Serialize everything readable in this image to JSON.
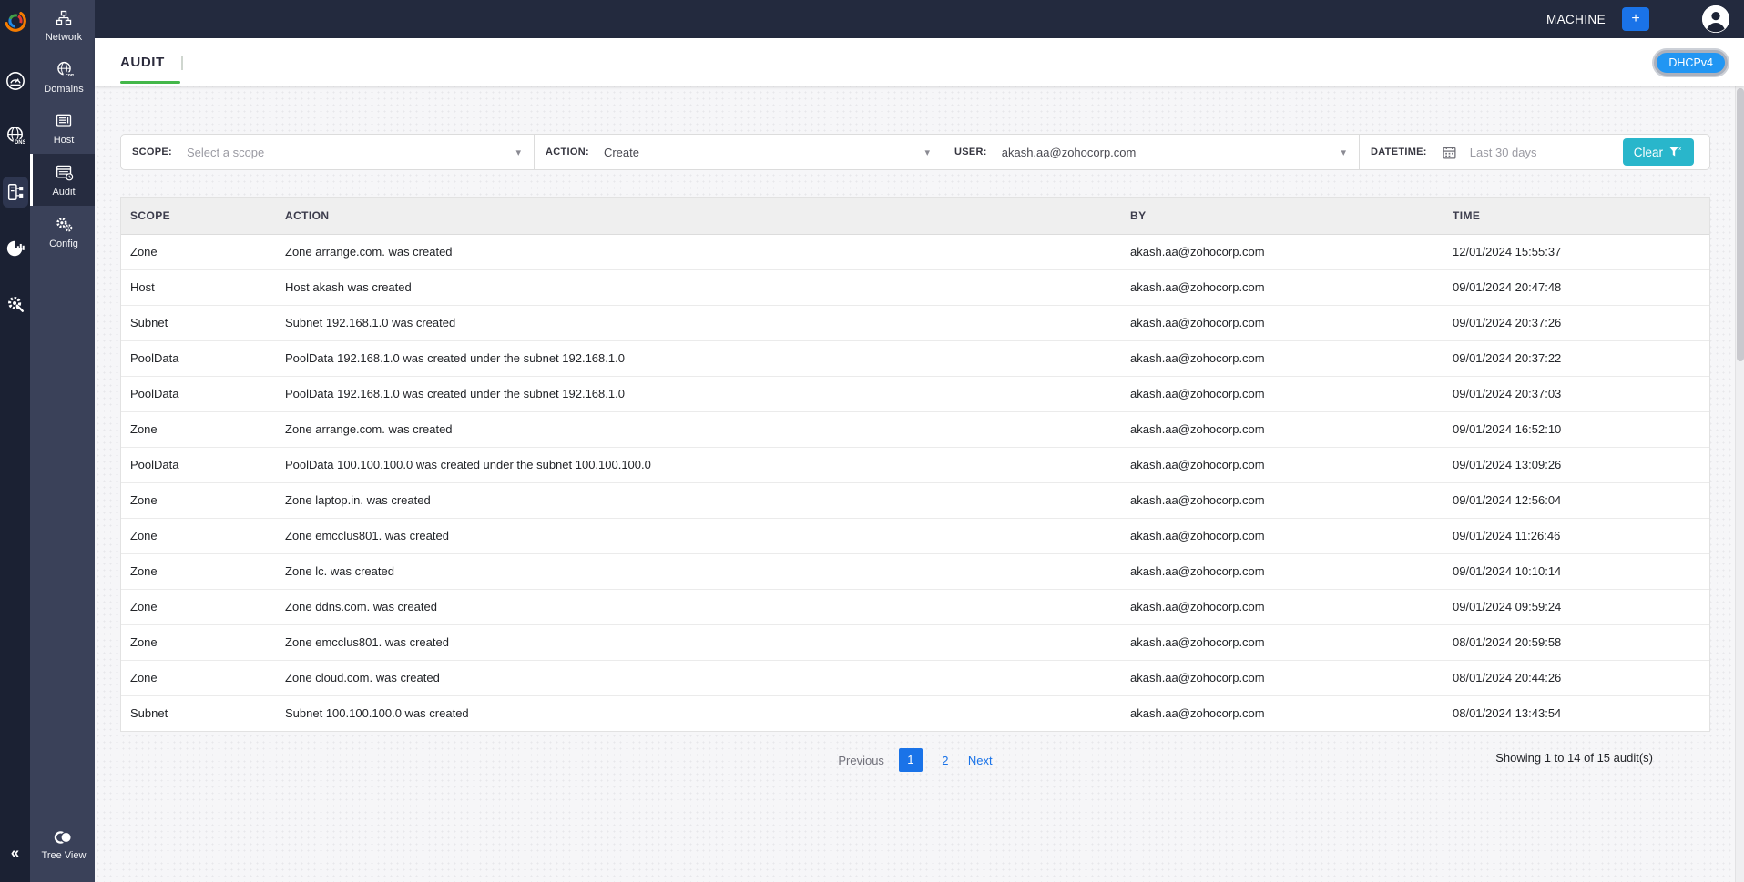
{
  "topbar": {
    "product_label": "MACHINE",
    "add_button_label": "+"
  },
  "page_header": {
    "tab_label": "AUDIT",
    "protocol_badge": "DHCPv4"
  },
  "icons": {
    "dropdown_glyph": "▾",
    "collapse_glyph": "«"
  },
  "sidebar": {
    "items": [
      {
        "label": "Network"
      },
      {
        "label": "Domains"
      },
      {
        "label": "Host"
      },
      {
        "label": "Audit"
      },
      {
        "label": "Config"
      }
    ],
    "bottom_item": {
      "label": "Tree View"
    }
  },
  "filters": {
    "scope": {
      "label": "SCOPE:",
      "placeholder": "Select a scope"
    },
    "action": {
      "label": "ACTION:",
      "value": "Create"
    },
    "user": {
      "label": "USER:",
      "value": "akash.aa@zohocorp.com"
    },
    "datetime": {
      "label": "DATETIME:",
      "placeholder": "Last 30 days"
    },
    "clear_button_label": "Clear"
  },
  "table": {
    "columns": [
      "SCOPE",
      "ACTION",
      "BY",
      "TIME"
    ],
    "rows": [
      [
        "Zone",
        "Zone arrange.com. was created",
        "akash.aa@zohocorp.com",
        "12/01/2024 15:55:37"
      ],
      [
        "Host",
        "Host akash was created",
        "akash.aa@zohocorp.com",
        "09/01/2024 20:47:48"
      ],
      [
        "Subnet",
        "Subnet 192.168.1.0 was created",
        "akash.aa@zohocorp.com",
        "09/01/2024 20:37:26"
      ],
      [
        "PoolData",
        "PoolData 192.168.1.0 was created under the subnet 192.168.1.0",
        "akash.aa@zohocorp.com",
        "09/01/2024 20:37:22"
      ],
      [
        "PoolData",
        "PoolData 192.168.1.0 was created under the subnet 192.168.1.0",
        "akash.aa@zohocorp.com",
        "09/01/2024 20:37:03"
      ],
      [
        "Zone",
        "Zone arrange.com. was created",
        "akash.aa@zohocorp.com",
        "09/01/2024 16:52:10"
      ],
      [
        "PoolData",
        "PoolData 100.100.100.0 was created under the subnet 100.100.100.0",
        "akash.aa@zohocorp.com",
        "09/01/2024 13:09:26"
      ],
      [
        "Zone",
        "Zone laptop.in. was created",
        "akash.aa@zohocorp.com",
        "09/01/2024 12:56:04"
      ],
      [
        "Zone",
        "Zone emcclus801. was created",
        "akash.aa@zohocorp.com",
        "09/01/2024 11:26:46"
      ],
      [
        "Zone",
        "Zone lc. was created",
        "akash.aa@zohocorp.com",
        "09/01/2024 10:10:14"
      ],
      [
        "Zone",
        "Zone ddns.com. was created",
        "akash.aa@zohocorp.com",
        "09/01/2024 09:59:24"
      ],
      [
        "Zone",
        "Zone emcclus801. was created",
        "akash.aa@zohocorp.com",
        "08/01/2024 20:59:58"
      ],
      [
        "Zone",
        "Zone cloud.com. was created",
        "akash.aa@zohocorp.com",
        "08/01/2024 20:44:26"
      ],
      [
        "Subnet",
        "Subnet 100.100.100.0 was created",
        "akash.aa@zohocorp.com",
        "08/01/2024 13:43:54"
      ]
    ]
  },
  "pagination": {
    "previous_label": "Previous",
    "pages": [
      "1",
      "2"
    ],
    "active_page": "1",
    "next_label": "Next",
    "summary": "Showing 1 to 14 of 15 audit(s)"
  },
  "colors": {
    "accent_blue": "#1a73e8",
    "badge_blue": "#2196f3",
    "clear_teal": "#29b6cb",
    "tab_green": "#43b749",
    "navbar": "#232a3e",
    "rail": "#1b2133",
    "sidebar": "#3a4159"
  }
}
